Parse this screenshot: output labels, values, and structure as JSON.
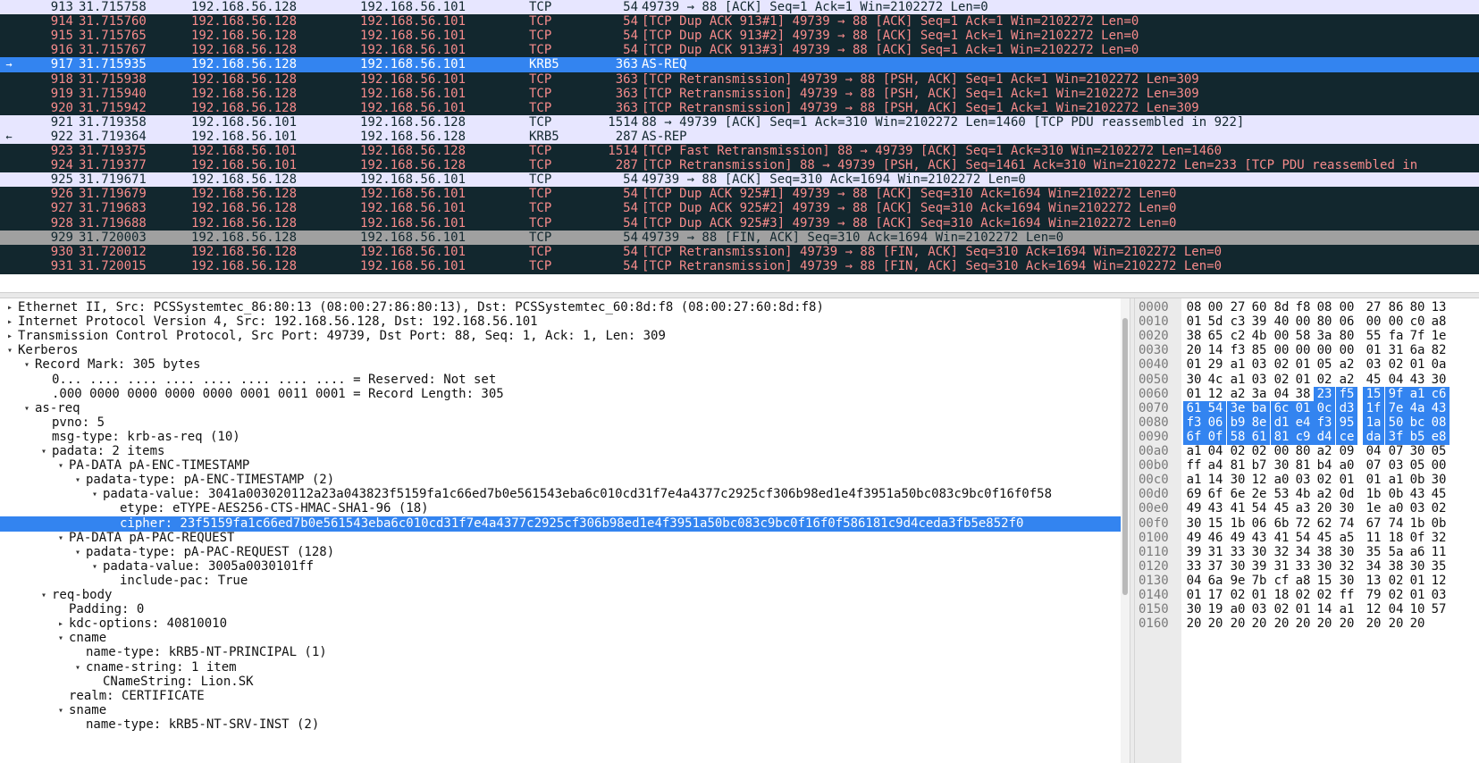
{
  "colors": {
    "dark_row_bg": "#12272e",
    "dark_row_fg": "#f78b8b",
    "light_row_bg": "#e7e6ff",
    "selected_bg": "#3384f0",
    "marked_bg": "#a0a0a0"
  },
  "packets": [
    {
      "no": "913",
      "time": "31.715758",
      "src": "192.168.56.128",
      "dst": "192.168.56.101",
      "proto": "TCP",
      "len": "54",
      "info": "49739 → 88 [ACK] Seq=1 Ack=1 Win=2102272 Len=0",
      "style": "light",
      "marker": ""
    },
    {
      "no": "914",
      "time": "31.715760",
      "src": "192.168.56.128",
      "dst": "192.168.56.101",
      "proto": "TCP",
      "len": "54",
      "info": "[TCP Dup ACK 913#1] 49739 → 88 [ACK] Seq=1 Ack=1 Win=2102272 Len=0",
      "style": "dark",
      "marker": ""
    },
    {
      "no": "915",
      "time": "31.715765",
      "src": "192.168.56.128",
      "dst": "192.168.56.101",
      "proto": "TCP",
      "len": "54",
      "info": "[TCP Dup ACK 913#2] 49739 → 88 [ACK] Seq=1 Ack=1 Win=2102272 Len=0",
      "style": "dark",
      "marker": ""
    },
    {
      "no": "916",
      "time": "31.715767",
      "src": "192.168.56.128",
      "dst": "192.168.56.101",
      "proto": "TCP",
      "len": "54",
      "info": "[TCP Dup ACK 913#3] 49739 → 88 [ACK] Seq=1 Ack=1 Win=2102272 Len=0",
      "style": "dark",
      "marker": ""
    },
    {
      "no": "917",
      "time": "31.715935",
      "src": "192.168.56.128",
      "dst": "192.168.56.101",
      "proto": "KRB5",
      "len": "363",
      "info": "AS-REQ",
      "style": "selected",
      "marker": "→"
    },
    {
      "no": "918",
      "time": "31.715938",
      "src": "192.168.56.128",
      "dst": "192.168.56.101",
      "proto": "TCP",
      "len": "363",
      "info": "[TCP Retransmission] 49739 → 88 [PSH, ACK] Seq=1 Ack=1 Win=2102272 Len=309",
      "style": "dark",
      "marker": ""
    },
    {
      "no": "919",
      "time": "31.715940",
      "src": "192.168.56.128",
      "dst": "192.168.56.101",
      "proto": "TCP",
      "len": "363",
      "info": "[TCP Retransmission] 49739 → 88 [PSH, ACK] Seq=1 Ack=1 Win=2102272 Len=309",
      "style": "dark",
      "marker": ""
    },
    {
      "no": "920",
      "time": "31.715942",
      "src": "192.168.56.128",
      "dst": "192.168.56.101",
      "proto": "TCP",
      "len": "363",
      "info": "[TCP Retransmission] 49739 → 88 [PSH, ACK] Seq=1 Ack=1 Win=2102272 Len=309",
      "style": "dark",
      "marker": ""
    },
    {
      "no": "921",
      "time": "31.719358",
      "src": "192.168.56.101",
      "dst": "192.168.56.128",
      "proto": "TCP",
      "len": "1514",
      "info": "88 → 49739 [ACK] Seq=1 Ack=310 Win=2102272 Len=1460 [TCP PDU reassembled in 922]",
      "style": "light",
      "marker": ""
    },
    {
      "no": "922",
      "time": "31.719364",
      "src": "192.168.56.101",
      "dst": "192.168.56.128",
      "proto": "KRB5",
      "len": "287",
      "info": "AS-REP",
      "style": "light",
      "marker": "←"
    },
    {
      "no": "923",
      "time": "31.719375",
      "src": "192.168.56.101",
      "dst": "192.168.56.128",
      "proto": "TCP",
      "len": "1514",
      "info": "[TCP Fast Retransmission] 88 → 49739 [ACK] Seq=1 Ack=310 Win=2102272 Len=1460",
      "style": "dark",
      "marker": ""
    },
    {
      "no": "924",
      "time": "31.719377",
      "src": "192.168.56.101",
      "dst": "192.168.56.128",
      "proto": "TCP",
      "len": "287",
      "info": "[TCP Retransmission] 88 → 49739 [PSH, ACK] Seq=1461 Ack=310 Win=2102272 Len=233 [TCP PDU reassembled in",
      "style": "dark",
      "marker": ""
    },
    {
      "no": "925",
      "time": "31.719671",
      "src": "192.168.56.128",
      "dst": "192.168.56.101",
      "proto": "TCP",
      "len": "54",
      "info": "49739 → 88 [ACK] Seq=310 Ack=1694 Win=2102272 Len=0",
      "style": "light",
      "marker": ""
    },
    {
      "no": "926",
      "time": "31.719679",
      "src": "192.168.56.128",
      "dst": "192.168.56.101",
      "proto": "TCP",
      "len": "54",
      "info": "[TCP Dup ACK 925#1] 49739 → 88 [ACK] Seq=310 Ack=1694 Win=2102272 Len=0",
      "style": "dark",
      "marker": ""
    },
    {
      "no": "927",
      "time": "31.719683",
      "src": "192.168.56.128",
      "dst": "192.168.56.101",
      "proto": "TCP",
      "len": "54",
      "info": "[TCP Dup ACK 925#2] 49739 → 88 [ACK] Seq=310 Ack=1694 Win=2102272 Len=0",
      "style": "dark",
      "marker": ""
    },
    {
      "no": "928",
      "time": "31.719688",
      "src": "192.168.56.128",
      "dst": "192.168.56.101",
      "proto": "TCP",
      "len": "54",
      "info": "[TCP Dup ACK 925#3] 49739 → 88 [ACK] Seq=310 Ack=1694 Win=2102272 Len=0",
      "style": "dark",
      "marker": ""
    },
    {
      "no": "929",
      "time": "31.720003",
      "src": "192.168.56.128",
      "dst": "192.168.56.101",
      "proto": "TCP",
      "len": "54",
      "info": "49739 → 88 [FIN, ACK] Seq=310 Ack=1694 Win=2102272 Len=0",
      "style": "gray",
      "marker": ""
    },
    {
      "no": "930",
      "time": "31.720012",
      "src": "192.168.56.128",
      "dst": "192.168.56.101",
      "proto": "TCP",
      "len": "54",
      "info": "[TCP Retransmission] 49739 → 88 [FIN, ACK] Seq=310 Ack=1694 Win=2102272 Len=0",
      "style": "dark",
      "marker": ""
    },
    {
      "no": "931",
      "time": "31.720015",
      "src": "192.168.56.128",
      "dst": "192.168.56.101",
      "proto": "TCP",
      "len": "54",
      "info": "[TCP Retransmission] 49739 → 88 [FIN, ACK] Seq=310 Ack=1694 Win=2102272 Len=0",
      "style": "dark",
      "marker": ""
    }
  ],
  "details": [
    {
      "depth": 0,
      "toggle": "collapsed",
      "text": "Ethernet II, Src: PCSSystemtec_86:80:13 (08:00:27:86:80:13), Dst: PCSSystemtec_60:8d:f8 (08:00:27:60:8d:f8)"
    },
    {
      "depth": 0,
      "toggle": "collapsed",
      "text": "Internet Protocol Version 4, Src: 192.168.56.128, Dst: 192.168.56.101"
    },
    {
      "depth": 0,
      "toggle": "collapsed",
      "text": "Transmission Control Protocol, Src Port: 49739, Dst Port: 88, Seq: 1, Ack: 1, Len: 309"
    },
    {
      "depth": 0,
      "toggle": "expanded",
      "text": "Kerberos"
    },
    {
      "depth": 1,
      "toggle": "expanded",
      "text": "Record Mark: 305 bytes"
    },
    {
      "depth": 2,
      "toggle": "none",
      "text": "0... .... .... .... .... .... .... .... = Reserved: Not set"
    },
    {
      "depth": 2,
      "toggle": "none",
      "text": ".000 0000 0000 0000 0000 0001 0011 0001 = Record Length: 305"
    },
    {
      "depth": 1,
      "toggle": "expanded",
      "text": "as-req"
    },
    {
      "depth": 2,
      "toggle": "none",
      "text": "pvno: 5"
    },
    {
      "depth": 2,
      "toggle": "none",
      "text": "msg-type: krb-as-req (10)"
    },
    {
      "depth": 2,
      "toggle": "expanded",
      "text": "padata: 2 items"
    },
    {
      "depth": 3,
      "toggle": "expanded",
      "text": "PA-DATA pA-ENC-TIMESTAMP"
    },
    {
      "depth": 4,
      "toggle": "expanded",
      "text": "padata-type: pA-ENC-TIMESTAMP (2)"
    },
    {
      "depth": 5,
      "toggle": "expanded",
      "text": "padata-value: 3041a003020112a23a043823f5159fa1c66ed7b0e561543eba6c010cd31f7e4a4377c2925cf306b98ed1e4f3951a50bc083c9bc0f16f0f58"
    },
    {
      "depth": 6,
      "toggle": "none",
      "text": "etype: eTYPE-AES256-CTS-HMAC-SHA1-96 (18)"
    },
    {
      "depth": 6,
      "toggle": "none",
      "text": "cipher: 23f5159fa1c66ed7b0e561543eba6c010cd31f7e4a4377c2925cf306b98ed1e4f3951a50bc083c9bc0f16f0f586181c9d4ceda3fb5e852f0",
      "selected": true
    },
    {
      "depth": 3,
      "toggle": "expanded",
      "text": "PA-DATA pA-PAC-REQUEST"
    },
    {
      "depth": 4,
      "toggle": "expanded",
      "text": "padata-type: pA-PAC-REQUEST (128)"
    },
    {
      "depth": 5,
      "toggle": "expanded",
      "text": "padata-value: 3005a0030101ff"
    },
    {
      "depth": 6,
      "toggle": "none",
      "text": "include-pac: True"
    },
    {
      "depth": 2,
      "toggle": "expanded",
      "text": "req-body"
    },
    {
      "depth": 3,
      "toggle": "none",
      "text": "Padding: 0"
    },
    {
      "depth": 3,
      "toggle": "collapsed",
      "text": "kdc-options: 40810010"
    },
    {
      "depth": 3,
      "toggle": "expanded",
      "text": "cname"
    },
    {
      "depth": 4,
      "toggle": "none",
      "text": "name-type: kRB5-NT-PRINCIPAL (1)"
    },
    {
      "depth": 4,
      "toggle": "expanded",
      "text": "cname-string: 1 item"
    },
    {
      "depth": 5,
      "toggle": "none",
      "text": "CNameString: Lion.SK"
    },
    {
      "depth": 3,
      "toggle": "none",
      "text": "realm: CERTIFICATE"
    },
    {
      "depth": 3,
      "toggle": "expanded",
      "text": "sname"
    },
    {
      "depth": 4,
      "toggle": "none",
      "text": "name-type: kRB5-NT-SRV-INST (2)"
    }
  ],
  "bytes": [
    {
      "offset": "0000",
      "hex": [
        "08",
        "00",
        "27",
        "60",
        "8d",
        "f8",
        "08",
        "00",
        "27",
        "86",
        "80",
        "13"
      ]
    },
    {
      "offset": "0010",
      "hex": [
        "01",
        "5d",
        "c3",
        "39",
        "40",
        "00",
        "80",
        "06",
        "00",
        "00",
        "c0",
        "a8"
      ]
    },
    {
      "offset": "0020",
      "hex": [
        "38",
        "65",
        "c2",
        "4b",
        "00",
        "58",
        "3a",
        "80",
        "55",
        "fa",
        "7f",
        "1e"
      ]
    },
    {
      "offset": "0030",
      "hex": [
        "20",
        "14",
        "f3",
        "85",
        "00",
        "00",
        "00",
        "00",
        "01",
        "31",
        "6a",
        "82"
      ]
    },
    {
      "offset": "0040",
      "hex": [
        "01",
        "29",
        "a1",
        "03",
        "02",
        "01",
        "05",
        "a2",
        "03",
        "02",
        "01",
        "0a"
      ]
    },
    {
      "offset": "0050",
      "hex": [
        "30",
        "4c",
        "a1",
        "03",
        "02",
        "01",
        "02",
        "a2",
        "45",
        "04",
        "43",
        "30"
      ]
    },
    {
      "offset": "0060",
      "hex": [
        "01",
        "12",
        "a2",
        "3a",
        "04",
        "38",
        "23",
        "f5",
        "15",
        "9f",
        "a1",
        "c6"
      ],
      "hl_from": 6
    },
    {
      "offset": "0070",
      "hex": [
        "61",
        "54",
        "3e",
        "ba",
        "6c",
        "01",
        "0c",
        "d3",
        "1f",
        "7e",
        "4a",
        "43"
      ],
      "hl_from": 0
    },
    {
      "offset": "0080",
      "hex": [
        "f3",
        "06",
        "b9",
        "8e",
        "d1",
        "e4",
        "f3",
        "95",
        "1a",
        "50",
        "bc",
        "08"
      ],
      "hl_from": 0
    },
    {
      "offset": "0090",
      "hex": [
        "6f",
        "0f",
        "58",
        "61",
        "81",
        "c9",
        "d4",
        "ce",
        "da",
        "3f",
        "b5",
        "e8"
      ],
      "hl_from": 0
    },
    {
      "offset": "00a0",
      "hex": [
        "a1",
        "04",
        "02",
        "02",
        "00",
        "80",
        "a2",
        "09",
        "04",
        "07",
        "30",
        "05"
      ]
    },
    {
      "offset": "00b0",
      "hex": [
        "ff",
        "a4",
        "81",
        "b7",
        "30",
        "81",
        "b4",
        "a0",
        "07",
        "03",
        "05",
        "00"
      ]
    },
    {
      "offset": "00c0",
      "hex": [
        "a1",
        "14",
        "30",
        "12",
        "a0",
        "03",
        "02",
        "01",
        "01",
        "a1",
        "0b",
        "30"
      ]
    },
    {
      "offset": "00d0",
      "hex": [
        "69",
        "6f",
        "6e",
        "2e",
        "53",
        "4b",
        "a2",
        "0d",
        "1b",
        "0b",
        "43",
        "45"
      ]
    },
    {
      "offset": "00e0",
      "hex": [
        "49",
        "43",
        "41",
        "54",
        "45",
        "a3",
        "20",
        "30",
        "1e",
        "a0",
        "03",
        "02"
      ]
    },
    {
      "offset": "00f0",
      "hex": [
        "30",
        "15",
        "1b",
        "06",
        "6b",
        "72",
        "62",
        "74",
        "67",
        "74",
        "1b",
        "0b"
      ]
    },
    {
      "offset": "0100",
      "hex": [
        "49",
        "46",
        "49",
        "43",
        "41",
        "54",
        "45",
        "a5",
        "11",
        "18",
        "0f",
        "32"
      ]
    },
    {
      "offset": "0110",
      "hex": [
        "39",
        "31",
        "33",
        "30",
        "32",
        "34",
        "38",
        "30",
        "35",
        "5a",
        "a6",
        "11"
      ]
    },
    {
      "offset": "0120",
      "hex": [
        "33",
        "37",
        "30",
        "39",
        "31",
        "33",
        "30",
        "32",
        "34",
        "38",
        "30",
        "35"
      ]
    },
    {
      "offset": "0130",
      "hex": [
        "04",
        "6a",
        "9e",
        "7b",
        "cf",
        "a8",
        "15",
        "30",
        "13",
        "02",
        "01",
        "12"
      ]
    },
    {
      "offset": "0140",
      "hex": [
        "01",
        "17",
        "02",
        "01",
        "18",
        "02",
        "02",
        "ff",
        "79",
        "02",
        "01",
        "03"
      ]
    },
    {
      "offset": "0150",
      "hex": [
        "30",
        "19",
        "a0",
        "03",
        "02",
        "01",
        "14",
        "a1",
        "12",
        "04",
        "10",
        "57"
      ]
    },
    {
      "offset": "0160",
      "hex": [
        "20",
        "20",
        "20",
        "20",
        "20",
        "20",
        "20",
        "20",
        "20",
        "20",
        "20"
      ]
    }
  ]
}
